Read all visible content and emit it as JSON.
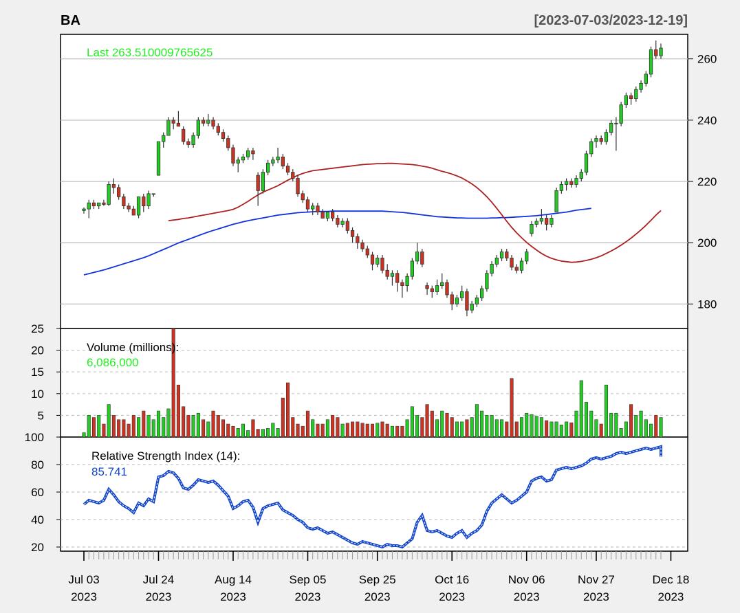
{
  "chart_data": {
    "type": "candlestick",
    "symbol": "BA",
    "date_range": "[2023-07-03/2023-12-19]",
    "last_label": "Last 263.510009765625",
    "colors": {
      "up": "#22cc22",
      "down": "#cc3322",
      "ma_short": "#aa2222",
      "ma_long": "#1133dd",
      "rsi": "#1144cc",
      "last_text": "#22ee22",
      "grid": "#cccccc"
    },
    "x_ticks": [
      {
        "line1": "Jul 03",
        "line2": "2023",
        "index": 0
      },
      {
        "line1": "Jul 24",
        "line2": "2023",
        "index": 15
      },
      {
        "line1": "Aug 14",
        "line2": "2023",
        "index": 30
      },
      {
        "line1": "Sep 05",
        "line2": "2023",
        "index": 45
      },
      {
        "line1": "Sep 25",
        "line2": "2023",
        "index": 59
      },
      {
        "line1": "Oct 16",
        "line2": "2023",
        "index": 74
      },
      {
        "line1": "Nov 06",
        "line2": "2023",
        "index": 89
      },
      {
        "line1": "Nov 27",
        "line2": "2023",
        "index": 103
      },
      {
        "line1": "Dec 18",
        "line2": "2023",
        "index": 118
      }
    ],
    "price_panel": {
      "ylim": [
        172,
        268
      ],
      "y_ticks": [
        180,
        200,
        220,
        240,
        260
      ],
      "ohlc": [
        [
          210.5,
          211.5,
          209.5,
          211
        ],
        [
          211,
          214,
          208,
          213
        ],
        [
          213,
          214,
          211,
          212
        ],
        [
          212,
          213,
          211,
          213
        ],
        [
          213,
          214,
          212,
          212.5
        ],
        [
          212.5,
          220,
          212,
          219
        ],
        [
          219,
          221,
          216,
          218
        ],
        [
          218,
          219,
          214,
          215
        ],
        [
          215,
          216,
          211,
          212
        ],
        [
          212,
          213,
          210,
          211
        ],
        [
          211,
          212,
          209,
          209
        ],
        [
          209,
          215,
          208,
          215
        ],
        [
          215,
          216,
          210,
          212
        ],
        [
          212,
          217,
          211,
          216
        ],
        [
          216,
          216,
          215,
          216
        ],
        [
          222,
          233,
          222,
          233
        ],
        [
          233,
          236,
          231,
          235
        ],
        [
          235,
          241,
          235,
          240
        ],
        [
          240,
          241,
          237,
          239
        ],
        [
          239,
          243,
          238,
          238
        ],
        [
          237,
          238,
          232,
          233
        ],
        [
          233,
          234,
          231,
          232
        ],
        [
          232,
          236,
          231,
          235
        ],
        [
          235,
          241,
          234,
          240
        ],
        [
          240,
          241,
          238,
          239
        ],
        [
          239,
          242,
          238,
          240
        ],
        [
          240,
          241,
          237,
          238
        ],
        [
          238,
          239,
          235,
          236
        ],
        [
          236,
          237,
          233,
          234
        ],
        [
          234,
          235,
          230,
          231
        ],
        [
          231,
          232,
          225,
          226
        ],
        [
          226,
          228,
          223,
          227
        ],
        [
          227,
          229,
          226,
          228
        ],
        [
          228,
          231,
          227,
          230
        ],
        [
          230,
          231,
          227,
          229
        ],
        [
          222,
          223,
          212,
          217
        ],
        [
          217,
          224,
          216,
          223
        ],
        [
          223,
          227,
          222,
          226
        ],
        [
          226,
          228,
          225,
          227
        ],
        [
          227,
          231,
          226,
          228
        ],
        [
          228,
          229,
          224,
          225
        ],
        [
          225,
          226,
          222,
          223
        ],
        [
          223,
          224,
          220,
          221
        ],
        [
          221,
          222,
          215,
          216
        ],
        [
          216,
          217,
          213,
          214
        ],
        [
          214,
          215,
          210,
          211
        ],
        [
          211,
          213,
          209,
          212
        ],
        [
          212,
          213,
          209,
          210
        ],
        [
          210,
          211,
          208,
          208
        ],
        [
          208,
          210,
          207,
          210
        ],
        [
          210,
          211,
          207,
          208
        ],
        [
          208,
          209,
          205,
          206
        ],
        [
          206,
          208,
          205,
          207
        ],
        [
          207,
          208,
          203,
          204
        ],
        [
          204,
          205,
          200,
          202
        ],
        [
          202,
          203,
          198,
          200
        ],
        [
          200,
          201,
          197,
          198
        ],
        [
          198,
          199,
          195,
          196
        ],
        [
          196,
          197,
          191,
          193
        ],
        [
          193,
          196,
          192,
          195
        ],
        [
          195,
          196,
          190,
          191
        ],
        [
          191,
          193,
          188,
          189
        ],
        [
          189,
          191,
          186,
          190
        ],
        [
          190,
          191,
          184,
          187
        ],
        [
          187,
          188,
          182,
          186
        ],
        [
          186,
          190,
          184,
          189
        ],
        [
          189,
          195,
          188,
          194
        ],
        [
          194,
          200,
          193,
          197
        ],
        [
          197,
          198,
          192,
          193
        ],
        [
          186,
          187,
          183,
          185
        ],
        [
          185,
          186,
          182,
          184
        ],
        [
          184,
          188,
          183,
          186
        ],
        [
          186,
          190,
          185,
          187
        ],
        [
          187,
          188,
          182,
          183
        ],
        [
          183,
          184,
          178,
          180
        ],
        [
          180,
          183,
          179,
          182
        ],
        [
          182,
          186,
          181,
          184
        ],
        [
          184,
          185,
          176,
          178
        ],
        [
          178,
          181,
          177,
          180
        ],
        [
          180,
          183,
          179,
          182
        ],
        [
          182,
          186,
          181,
          185
        ],
        [
          185,
          191,
          184,
          190
        ],
        [
          190,
          194,
          189,
          193
        ],
        [
          193,
          196,
          192,
          195
        ],
        [
          195,
          198,
          194,
          197
        ],
        [
          197,
          198,
          194,
          195
        ],
        [
          195,
          196,
          191,
          192
        ],
        [
          192,
          193,
          190,
          191
        ],
        [
          191,
          195,
          190,
          194
        ],
        [
          194,
          198,
          193,
          197
        ],
        [
          203,
          207,
          202,
          206
        ],
        [
          206,
          208,
          205,
          207
        ],
        [
          207,
          211,
          206,
          208
        ],
        [
          208,
          209,
          204,
          206
        ],
        [
          206,
          209,
          205,
          208
        ],
        [
          210,
          218,
          210,
          217
        ],
        [
          217,
          220,
          216,
          219
        ],
        [
          219,
          221,
          217,
          220
        ],
        [
          220,
          221,
          218,
          219
        ],
        [
          219,
          222,
          218,
          221
        ],
        [
          221,
          224,
          220,
          223
        ],
        [
          223,
          230,
          222,
          229
        ],
        [
          229,
          234,
          228,
          233
        ],
        [
          233,
          235,
          231,
          234
        ],
        [
          234,
          235,
          232,
          233
        ],
        [
          233,
          237,
          232,
          236
        ],
        [
          236,
          240,
          235,
          239
        ],
        [
          239,
          241,
          230,
          239
        ],
        [
          239,
          246,
          238,
          245
        ],
        [
          245,
          249,
          244,
          248
        ],
        [
          248,
          249,
          245,
          247
        ],
        [
          247,
          251,
          246,
          250
        ],
        [
          250,
          253,
          249,
          252
        ],
        [
          252,
          256,
          251,
          255
        ],
        [
          255,
          264,
          254,
          263
        ],
        [
          263,
          266,
          260,
          261
        ],
        [
          261,
          265,
          260,
          263.51
        ]
      ],
      "ma_short": [
        207.2,
        207.4,
        207.6,
        207.9,
        208.1,
        208.4,
        208.7,
        209.0,
        209.3,
        209.6,
        209.9,
        210.2,
        210.5,
        210.9,
        211.6,
        212.5,
        213.5,
        214.6,
        215.6,
        216.5,
        217.2,
        217.9,
        218.6,
        219.5,
        220.4,
        221.2,
        222.0,
        222.6,
        223.1,
        223.5,
        223.7,
        223.9,
        224.1,
        224.3,
        224.5,
        224.7,
        224.9,
        225.1,
        225.3,
        225.5,
        225.6,
        225.7,
        225.8,
        225.8,
        225.9,
        225.9,
        225.8,
        225.7,
        225.6,
        225.5,
        225.3,
        225.0,
        224.7,
        224.3,
        223.8,
        223.3,
        222.9,
        222.4,
        221.8,
        221.1,
        220.2,
        219.2,
        218.0,
        216.6,
        215.0,
        213.2,
        211.2,
        209.1,
        207.0,
        205.0,
        203.2,
        201.6,
        200.1,
        198.8,
        197.6,
        196.5,
        195.6,
        194.9,
        194.4,
        194.0,
        193.8,
        193.6,
        193.7,
        193.9,
        194.2,
        194.6,
        195.1,
        195.7,
        196.5,
        197.3,
        198.2,
        199.2,
        200.3,
        201.5,
        202.8,
        204.2,
        205.7,
        207.3,
        209.0,
        210.5
      ],
      "ma_short_offset": 17,
      "ma_long": [
        189.5,
        189.9,
        190.3,
        190.7,
        191.1,
        191.6,
        192.1,
        192.6,
        193.1,
        193.6,
        194.1,
        194.6,
        195.1,
        195.7,
        196.4,
        197.1,
        197.8,
        198.5,
        199.2,
        199.9,
        200.5,
        201.1,
        201.7,
        202.3,
        202.9,
        203.5,
        204.0,
        204.5,
        205.0,
        205.5,
        206.0,
        206.4,
        206.8,
        207.2,
        207.5,
        207.8,
        208.1,
        208.4,
        208.7,
        209.0,
        209.2,
        209.4,
        209.6,
        209.8,
        209.9,
        210.0,
        210.1,
        210.2,
        210.2,
        210.2,
        210.3,
        210.3,
        210.3,
        210.3,
        210.3,
        210.3,
        210.3,
        210.3,
        210.3,
        210.3,
        210.3,
        210.2,
        210.1,
        210.0,
        209.9,
        209.7,
        209.5,
        209.3,
        209.1,
        208.9,
        208.7,
        208.5,
        208.4,
        208.3,
        208.2,
        208.1,
        208.1,
        208.0,
        208.0,
        208.0,
        208.0,
        208.0,
        208.1,
        208.1,
        208.2,
        208.2,
        208.3,
        208.4,
        208.5,
        208.6,
        208.7,
        208.8,
        209.0,
        209.2,
        209.4,
        209.6,
        209.8,
        210.0,
        210.3,
        210.6,
        210.8,
        211.0,
        211.2
      ]
    },
    "volume_panel": {
      "title": "Volume (millions):",
      "last_value": "6,086,000",
      "ylim": [
        0,
        25
      ],
      "y_ticks": [
        5,
        10,
        15,
        20,
        25
      ],
      "values": [
        1,
        5,
        4.5,
        5,
        3,
        7.5,
        5,
        4,
        4,
        3,
        5,
        4.5,
        6,
        5,
        4,
        6,
        4.5,
        6.5,
        25,
        12,
        7,
        5,
        5,
        5.5,
        4,
        3.5,
        6,
        5,
        4,
        3,
        2.5,
        2,
        3,
        1.5,
        4,
        1.8,
        1.8,
        2,
        3.2,
        2,
        9,
        12.5,
        4.5,
        3,
        2.5,
        6,
        4,
        3,
        3,
        4,
        5,
        4.5,
        3,
        3.2,
        3.5,
        3.5,
        3.2,
        3,
        3,
        3.2,
        3.5,
        3,
        2.5,
        2.5,
        2.5,
        4,
        7,
        5,
        4.5,
        7.5,
        6,
        4,
        6,
        5.5,
        4.5,
        3.5,
        3.5,
        4,
        4.5,
        7.5,
        6,
        5,
        5,
        4,
        4,
        3.5,
        13.5,
        3.5,
        4.5,
        5.5,
        5.2,
        4.8,
        4.5,
        3.8,
        3.5,
        3.5,
        2.8,
        3.5,
        3.3,
        6,
        13,
        8,
        6,
        4,
        3,
        12,
        5.5,
        5.5,
        2,
        3.5,
        7.5,
        5,
        6,
        4,
        3,
        5,
        4.5,
        6,
        6.5,
        6,
        5.5,
        7.5,
        15.5,
        6,
        6
      ]
    },
    "rsi_panel": {
      "title": "Relative Strength Index (14):",
      "last_value": "85.741",
      "ylim": [
        17,
        100
      ],
      "y_ticks": [
        20,
        40,
        60,
        80,
        100
      ],
      "values": [
        51,
        54,
        53,
        52,
        54,
        62,
        58,
        53,
        50,
        48,
        45,
        52,
        50,
        55,
        53,
        71,
        72,
        75,
        74,
        70,
        63,
        62,
        65,
        69,
        68,
        67,
        68,
        65,
        61,
        57,
        48,
        50,
        53,
        54,
        49,
        38,
        48,
        50,
        51,
        52,
        47,
        45,
        43,
        40,
        38,
        34,
        33,
        34,
        32,
        30,
        31,
        29,
        27,
        25,
        23,
        22,
        24,
        23,
        22,
        21,
        20,
        22,
        21,
        21,
        20,
        23,
        26,
        38,
        43,
        32,
        31,
        32,
        30,
        28,
        27,
        30,
        32,
        27,
        30,
        32,
        36,
        46,
        52,
        55,
        58,
        55,
        52,
        54,
        57,
        60,
        68,
        70,
        71,
        68,
        69,
        76,
        77,
        78,
        77,
        78,
        79,
        81,
        84,
        85,
        84,
        85,
        86,
        88,
        89,
        88,
        89,
        90,
        91,
        92,
        91,
        92,
        93,
        86,
        85.741
      ]
    }
  }
}
